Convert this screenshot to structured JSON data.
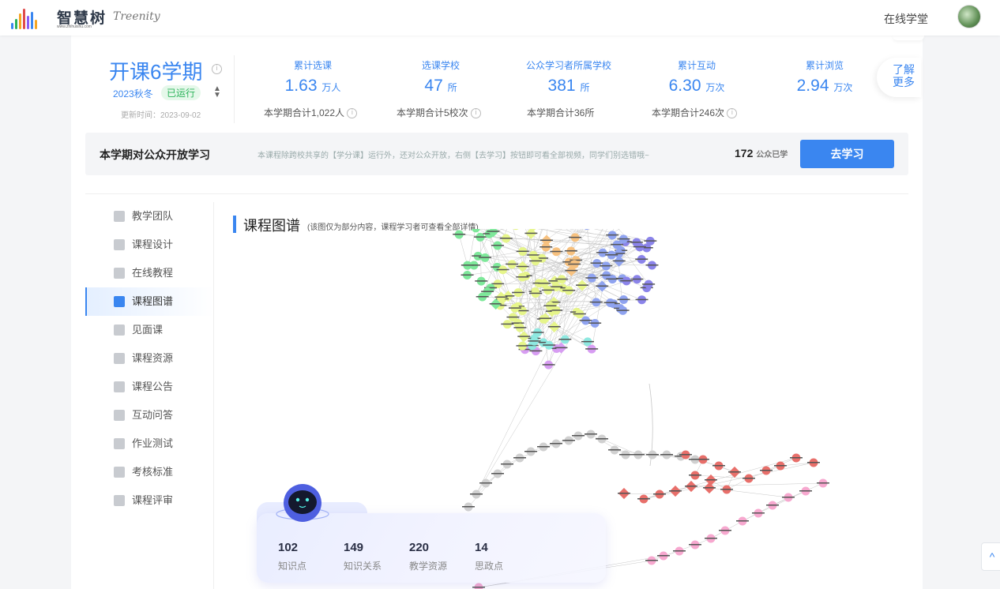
{
  "header": {
    "logo_cn": "智慧树",
    "logo_url_text": "www.zhihuishu.com",
    "logo_en": "Treenity",
    "nav_online": "在线学堂"
  },
  "course": {
    "term_title": "开课6学期",
    "season": "2023秋冬",
    "status": "已运行",
    "update_time": "更新时间：2023-09-02"
  },
  "stats": [
    {
      "label": "累计选课",
      "value": "1.63",
      "unit": "万人",
      "sub": "本学期合计1,022人",
      "has_info": true
    },
    {
      "label": "选课学校",
      "value": "47",
      "unit": "所",
      "sub": "本学期合计5校次",
      "has_info": true
    },
    {
      "label": "公众学习者所属学校",
      "value": "381",
      "unit": "所",
      "sub": "本学期合计36所",
      "has_info": false
    },
    {
      "label": "累计互动",
      "value": "6.30",
      "unit": "万次",
      "sub": "本学期合计246次",
      "has_info": true
    },
    {
      "label": "累计浏览",
      "value": "2.94",
      "unit": "万次",
      "sub": "",
      "has_info": false
    }
  ],
  "learn_more": "了解更多",
  "public_banner": {
    "title": "本学期对公众开放学习",
    "desc": "本课程除跨校共享的【学分课】运行外，还对公众开放，右侧【去学习】按钮即可看全部视频，同学们别选错哦~",
    "count": "172",
    "count_label": "公众已学",
    "button": "去学习"
  },
  "menu": [
    {
      "label": "教学团队",
      "icon": "graduation-cap-icon",
      "active": false
    },
    {
      "label": "课程设计",
      "icon": "design-icon",
      "active": false
    },
    {
      "label": "在线教程",
      "icon": "video-play-icon",
      "active": false
    },
    {
      "label": "课程图谱",
      "icon": "graph-book-icon",
      "active": true
    },
    {
      "label": "见面课",
      "icon": "people-icon",
      "active": false
    },
    {
      "label": "课程资源",
      "icon": "resource-icon",
      "active": false
    },
    {
      "label": "课程公告",
      "icon": "megaphone-icon",
      "active": false
    },
    {
      "label": "互动问答",
      "icon": "chat-bubble-icon",
      "active": false
    },
    {
      "label": "作业测试",
      "icon": "pencil-icon",
      "active": false
    },
    {
      "label": "考核标准",
      "icon": "checklist-icon",
      "active": false
    },
    {
      "label": "课程评审",
      "icon": "bar-chart-icon",
      "active": false
    }
  ],
  "graph": {
    "title": "课程图谱",
    "note": "(该图仅为部分内容，课程学习者可查看全部详情)",
    "node_colors": [
      "#7ee89a",
      "#e6f58a",
      "#f7c17f",
      "#8fa3f0",
      "#8b84ea",
      "#8ee8e0",
      "#d79df2",
      "#d0d0d0",
      "#e86f6a",
      "#f7a8cf"
    ]
  },
  "graph_stats": [
    {
      "value": "102",
      "label": "知识点"
    },
    {
      "value": "149",
      "label": "知识关系"
    },
    {
      "value": "220",
      "label": "教学资源"
    },
    {
      "value": "14",
      "label": "思政点"
    }
  ],
  "back_to_top": "^"
}
